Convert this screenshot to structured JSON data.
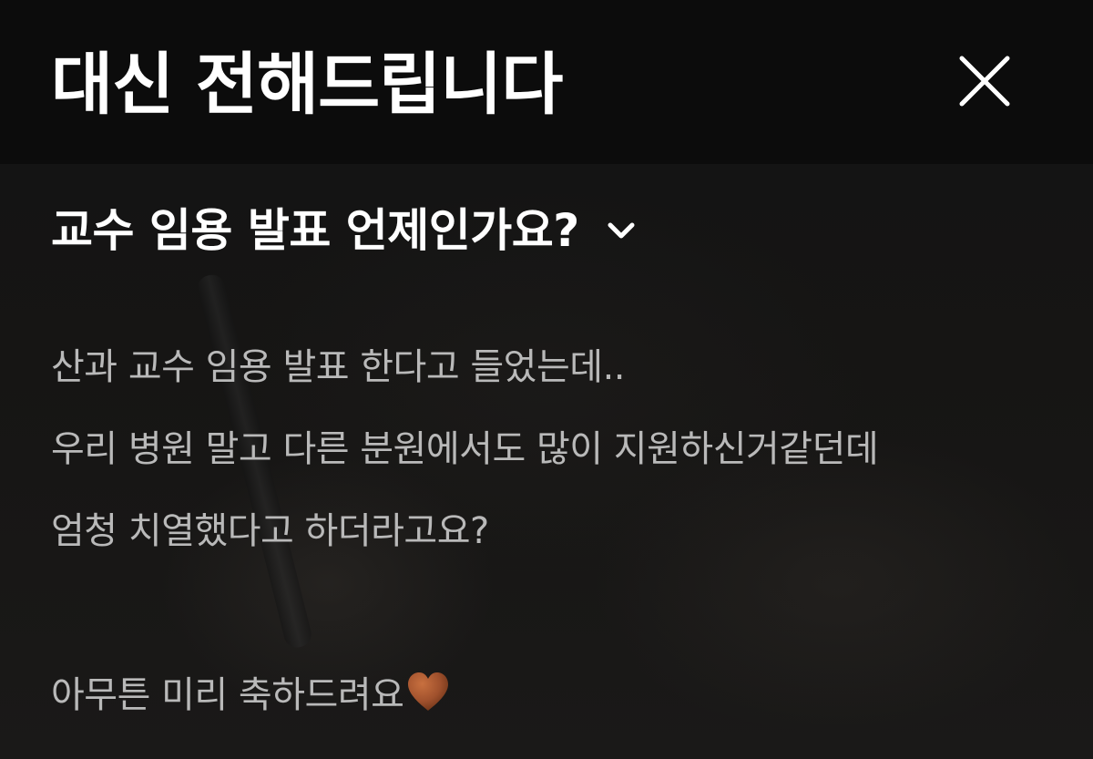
{
  "header": {
    "title": "대신 전해드립니다",
    "close_icon": "close-icon"
  },
  "question": {
    "text": "교수 임용 발표 언제인가요?",
    "toggle_icon": "chevron-down-icon"
  },
  "message": {
    "lines": [
      "산과 교수 임용 발표 한다고 들었는데..",
      "우리 병원 말고 다른 분원에서도 많이 지원하신거같던데",
      "엄청 치열했다고 하더라고요?",
      "",
      "아무튼 미리 축하드려요"
    ],
    "emoji_icon": "brown-heart-icon"
  },
  "colors": {
    "background": "#0f0f0f",
    "header_background": "#0c0c0c",
    "title": "#ffffff",
    "body_text": "#b9b9b9",
    "heart": "#a0512d"
  }
}
